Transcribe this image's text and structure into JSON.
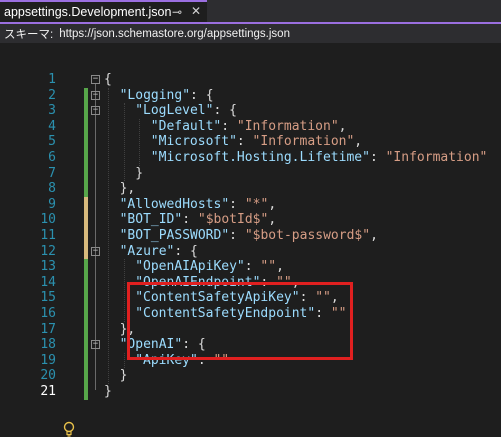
{
  "tab": {
    "title": "appsettings.Development.json",
    "pin_icon": "pin-icon",
    "close_icon": "close-icon",
    "accent": "#9b6fe0"
  },
  "schema": {
    "label": "スキーマ:",
    "url": "https://json.schemastore.org/appsettings.json"
  },
  "editor": {
    "line_numbers": [
      "1",
      "2",
      "3",
      "4",
      "5",
      "6",
      "7",
      "8",
      "9",
      "10",
      "11",
      "12",
      "13",
      "14",
      "15",
      "16",
      "17",
      "18",
      "19",
      "20",
      "21"
    ],
    "current_line": "21",
    "lines": [
      [
        [
          "punct",
          "{"
        ]
      ],
      [
        [
          "key",
          "\"Logging\""
        ],
        [
          "punct",
          ": {"
        ]
      ],
      [
        [
          "key",
          "\"LogLevel\""
        ],
        [
          "punct",
          ": {"
        ]
      ],
      [
        [
          "key",
          "\"Default\""
        ],
        [
          "punct",
          ": "
        ],
        [
          "str",
          "\"Information\""
        ],
        [
          "punct",
          ","
        ]
      ],
      [
        [
          "key",
          "\"Microsoft\""
        ],
        [
          "punct",
          ": "
        ],
        [
          "str",
          "\"Information\""
        ],
        [
          "punct",
          ","
        ]
      ],
      [
        [
          "key",
          "\"Microsoft.Hosting.Lifetime\""
        ],
        [
          "punct",
          ": "
        ],
        [
          "str",
          "\"Information\""
        ]
      ],
      [
        [
          "punct",
          "}"
        ]
      ],
      [
        [
          "punct",
          "},"
        ]
      ],
      [
        [
          "key",
          "\"AllowedHosts\""
        ],
        [
          "punct",
          ": "
        ],
        [
          "str",
          "\"*\""
        ],
        [
          "punct",
          ","
        ]
      ],
      [
        [
          "key",
          "\"BOT_ID\""
        ],
        [
          "punct",
          ": "
        ],
        [
          "str",
          "\"$botId$\""
        ],
        [
          "punct",
          ","
        ]
      ],
      [
        [
          "key",
          "\"BOT_PASSWORD\""
        ],
        [
          "punct",
          ": "
        ],
        [
          "str",
          "\"$bot-password$\""
        ],
        [
          "punct",
          ","
        ]
      ],
      [
        [
          "key",
          "\"Azure\""
        ],
        [
          "punct",
          ": {"
        ]
      ],
      [
        [
          "key",
          "\"OpenAIApiKey\""
        ],
        [
          "punct",
          ": "
        ],
        [
          "str",
          "\"\""
        ],
        [
          "punct",
          ","
        ]
      ],
      [
        [
          "key",
          "\"OpenAIEndpoint\""
        ],
        [
          "punct",
          ": "
        ],
        [
          "str",
          "\"\""
        ],
        [
          "punct",
          ","
        ]
      ],
      [
        [
          "key",
          "\"ContentSafetyApiKey\""
        ],
        [
          "punct",
          ": "
        ],
        [
          "str",
          "\"\""
        ],
        [
          "punct",
          ","
        ]
      ],
      [
        [
          "key",
          "\"ContentSafetyEndpoint\""
        ],
        [
          "punct",
          ": "
        ],
        [
          "str",
          "\"\""
        ]
      ],
      [
        [
          "punct",
          "},"
        ]
      ],
      [
        [
          "key",
          "\"OpenAI\""
        ],
        [
          "punct",
          ": {"
        ]
      ],
      [
        [
          "key",
          "\"ApiKey\""
        ],
        [
          "punct",
          ": "
        ],
        [
          "str",
          "\"\""
        ]
      ],
      [
        [
          "punct",
          "}"
        ]
      ],
      [
        [
          "punct",
          "}"
        ]
      ]
    ],
    "colors": {
      "key": "#9cdcfe",
      "string": "#d69d85",
      "punct": "#dcdcdc",
      "line_number": "#2b91af",
      "highlight_box": "#e02020",
      "change_saved": "#57a64a",
      "change_unsaved": "#d7ba7d"
    },
    "lightbulb_icon": "lightbulb-icon"
  }
}
